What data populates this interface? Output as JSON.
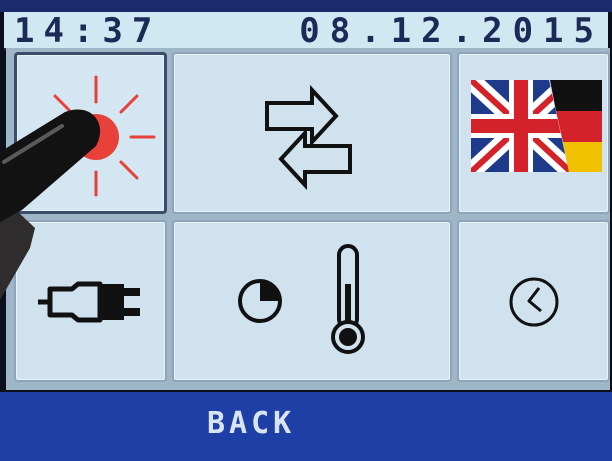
{
  "status": {
    "time": "14:37",
    "date": "08.12.2015"
  },
  "tiles": [
    {
      "name": "brightness-button",
      "icon": "sun-icon",
      "selected": true
    },
    {
      "name": "data-transfer-button",
      "icon": "swap-arrows-icon"
    },
    {
      "name": "language-button",
      "icon": "uk-germany-flag-icon"
    },
    {
      "name": "power-button",
      "icon": "plug-icon"
    },
    {
      "name": "timer-temperature-button",
      "icon": "timer-thermometer-icon"
    },
    {
      "name": "clock-button",
      "icon": "clock-icon"
    }
  ],
  "footer": {
    "back_label": "BACK"
  },
  "colors": {
    "header_bg": "#cfe8f2",
    "tile_bg": "#cfe2ee",
    "footer_bg": "#1d3fa6",
    "sun": "#e8413a"
  }
}
